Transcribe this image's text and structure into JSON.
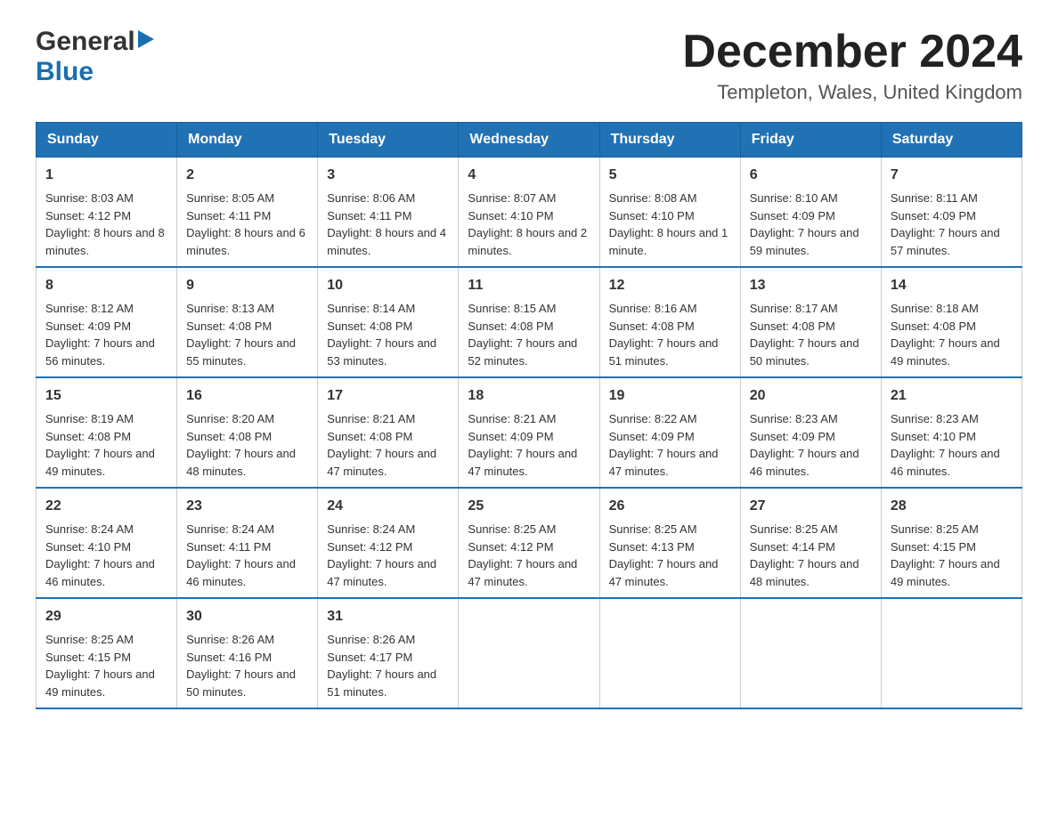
{
  "header": {
    "logo_general": "General",
    "logo_blue": "Blue",
    "month_title": "December 2024",
    "location": "Templeton, Wales, United Kingdom"
  },
  "columns": [
    "Sunday",
    "Monday",
    "Tuesday",
    "Wednesday",
    "Thursday",
    "Friday",
    "Saturday"
  ],
  "weeks": [
    [
      {
        "day": "1",
        "sunrise": "8:03 AM",
        "sunset": "4:12 PM",
        "daylight": "8 hours and 8 minutes."
      },
      {
        "day": "2",
        "sunrise": "8:05 AM",
        "sunset": "4:11 PM",
        "daylight": "8 hours and 6 minutes."
      },
      {
        "day": "3",
        "sunrise": "8:06 AM",
        "sunset": "4:11 PM",
        "daylight": "8 hours and 4 minutes."
      },
      {
        "day": "4",
        "sunrise": "8:07 AM",
        "sunset": "4:10 PM",
        "daylight": "8 hours and 2 minutes."
      },
      {
        "day": "5",
        "sunrise": "8:08 AM",
        "sunset": "4:10 PM",
        "daylight": "8 hours and 1 minute."
      },
      {
        "day": "6",
        "sunrise": "8:10 AM",
        "sunset": "4:09 PM",
        "daylight": "7 hours and 59 minutes."
      },
      {
        "day": "7",
        "sunrise": "8:11 AM",
        "sunset": "4:09 PM",
        "daylight": "7 hours and 57 minutes."
      }
    ],
    [
      {
        "day": "8",
        "sunrise": "8:12 AM",
        "sunset": "4:09 PM",
        "daylight": "7 hours and 56 minutes."
      },
      {
        "day": "9",
        "sunrise": "8:13 AM",
        "sunset": "4:08 PM",
        "daylight": "7 hours and 55 minutes."
      },
      {
        "day": "10",
        "sunrise": "8:14 AM",
        "sunset": "4:08 PM",
        "daylight": "7 hours and 53 minutes."
      },
      {
        "day": "11",
        "sunrise": "8:15 AM",
        "sunset": "4:08 PM",
        "daylight": "7 hours and 52 minutes."
      },
      {
        "day": "12",
        "sunrise": "8:16 AM",
        "sunset": "4:08 PM",
        "daylight": "7 hours and 51 minutes."
      },
      {
        "day": "13",
        "sunrise": "8:17 AM",
        "sunset": "4:08 PM",
        "daylight": "7 hours and 50 minutes."
      },
      {
        "day": "14",
        "sunrise": "8:18 AM",
        "sunset": "4:08 PM",
        "daylight": "7 hours and 49 minutes."
      }
    ],
    [
      {
        "day": "15",
        "sunrise": "8:19 AM",
        "sunset": "4:08 PM",
        "daylight": "7 hours and 49 minutes."
      },
      {
        "day": "16",
        "sunrise": "8:20 AM",
        "sunset": "4:08 PM",
        "daylight": "7 hours and 48 minutes."
      },
      {
        "day": "17",
        "sunrise": "8:21 AM",
        "sunset": "4:08 PM",
        "daylight": "7 hours and 47 minutes."
      },
      {
        "day": "18",
        "sunrise": "8:21 AM",
        "sunset": "4:09 PM",
        "daylight": "7 hours and 47 minutes."
      },
      {
        "day": "19",
        "sunrise": "8:22 AM",
        "sunset": "4:09 PM",
        "daylight": "7 hours and 47 minutes."
      },
      {
        "day": "20",
        "sunrise": "8:23 AM",
        "sunset": "4:09 PM",
        "daylight": "7 hours and 46 minutes."
      },
      {
        "day": "21",
        "sunrise": "8:23 AM",
        "sunset": "4:10 PM",
        "daylight": "7 hours and 46 minutes."
      }
    ],
    [
      {
        "day": "22",
        "sunrise": "8:24 AM",
        "sunset": "4:10 PM",
        "daylight": "7 hours and 46 minutes."
      },
      {
        "day": "23",
        "sunrise": "8:24 AM",
        "sunset": "4:11 PM",
        "daylight": "7 hours and 46 minutes."
      },
      {
        "day": "24",
        "sunrise": "8:24 AM",
        "sunset": "4:12 PM",
        "daylight": "7 hours and 47 minutes."
      },
      {
        "day": "25",
        "sunrise": "8:25 AM",
        "sunset": "4:12 PM",
        "daylight": "7 hours and 47 minutes."
      },
      {
        "day": "26",
        "sunrise": "8:25 AM",
        "sunset": "4:13 PM",
        "daylight": "7 hours and 47 minutes."
      },
      {
        "day": "27",
        "sunrise": "8:25 AM",
        "sunset": "4:14 PM",
        "daylight": "7 hours and 48 minutes."
      },
      {
        "day": "28",
        "sunrise": "8:25 AM",
        "sunset": "4:15 PM",
        "daylight": "7 hours and 49 minutes."
      }
    ],
    [
      {
        "day": "29",
        "sunrise": "8:25 AM",
        "sunset": "4:15 PM",
        "daylight": "7 hours and 49 minutes."
      },
      {
        "day": "30",
        "sunrise": "8:26 AM",
        "sunset": "4:16 PM",
        "daylight": "7 hours and 50 minutes."
      },
      {
        "day": "31",
        "sunrise": "8:26 AM",
        "sunset": "4:17 PM",
        "daylight": "7 hours and 51 minutes."
      },
      null,
      null,
      null,
      null
    ]
  ]
}
